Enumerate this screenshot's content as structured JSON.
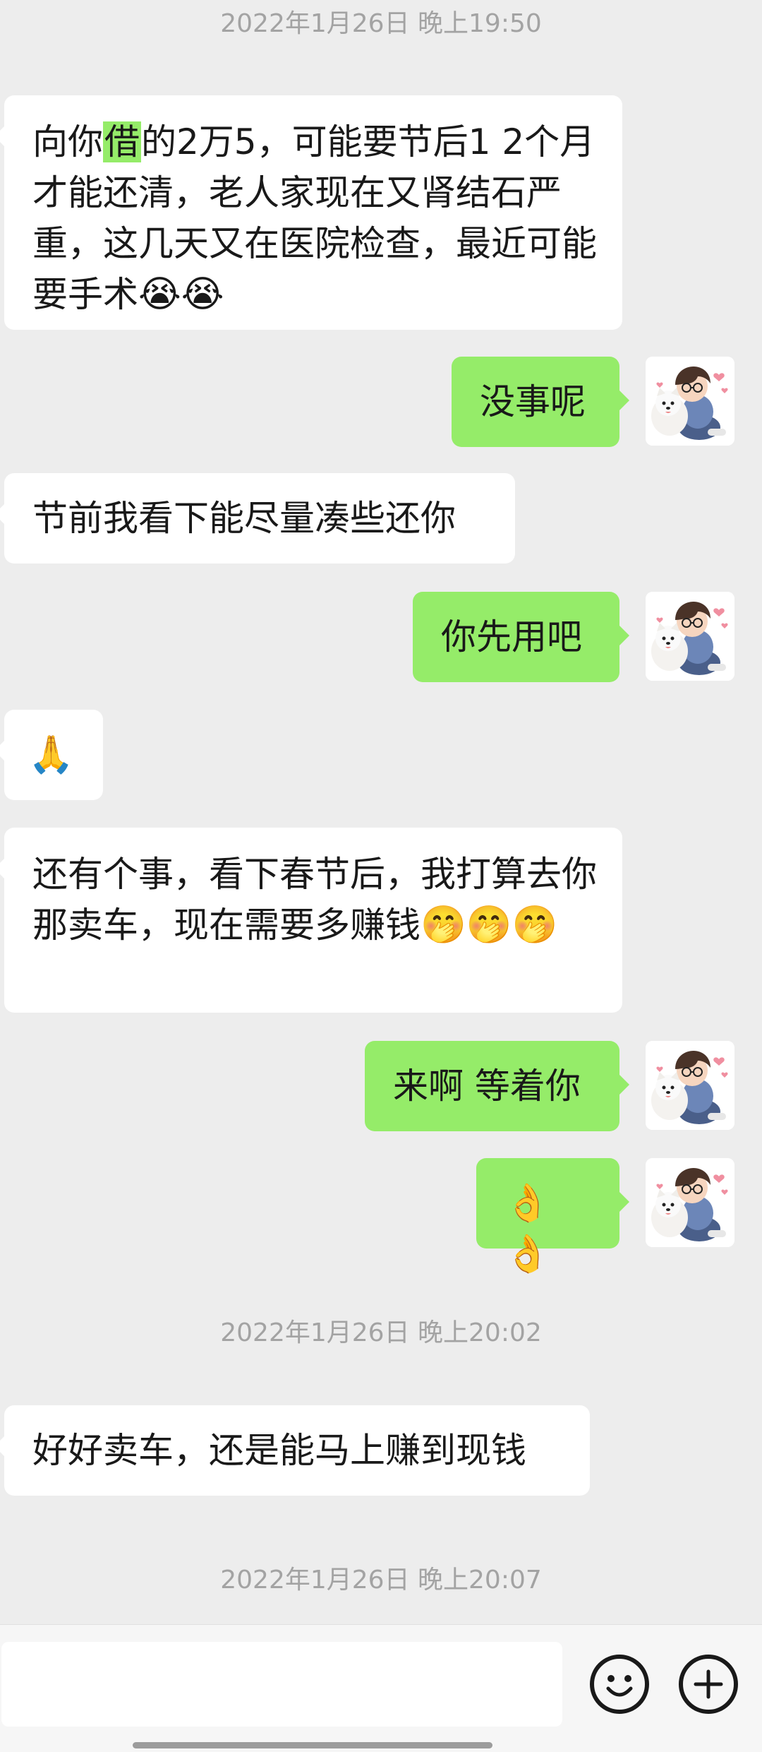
{
  "timestamps": [
    "2022年1月26日 晚上19:50",
    "2022年1月26日 晚上20:02",
    "2022年1月26日 晚上20:07"
  ],
  "messages": {
    "m1": {
      "pre": "向你",
      "highlight": "借",
      "post": "的2万5，可能要节后1 2个月才能还清，老人家现在又肾结石严重，这几天又在医院检查，最近可能要手术",
      "emoji": "😭😭"
    },
    "m2": {
      "text": "没事呢"
    },
    "m3": {
      "text": "节前我看下能尽量凑些还你"
    },
    "m4": {
      "text": "你先用吧"
    },
    "m5": {
      "emoji": "🙏"
    },
    "m6": {
      "text": "还有个事，看下春节后，我打算去你那卖车，现在需要多赚钱",
      "emoji": "🤭🤭🤭"
    },
    "m7": {
      "text": "来啊 等着你"
    },
    "m8": {
      "emoji": "👌👌"
    },
    "m9": {
      "text": "好好卖车，还是能马上赚到现钱"
    }
  },
  "colors": {
    "background": "#ededed",
    "incoming": "#ffffff",
    "outgoing": "#95ec69",
    "timestamp": "#a3a3a3"
  },
  "icons": {
    "emoji_button": "smiley-face-icon",
    "more_button": "plus-circle-icon",
    "avatar": "boy-with-dog-avatar"
  }
}
